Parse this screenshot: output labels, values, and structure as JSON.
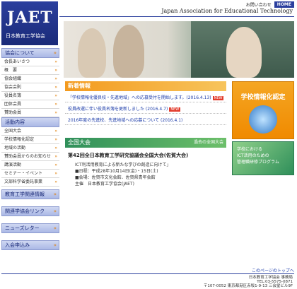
{
  "header": {
    "logo_text": "JAET",
    "logo_subtitle": "日本教育工学協会",
    "contact_link": "お問い合わせ",
    "home_link": "HOME",
    "english_name": "Japan Association for Educational Technology"
  },
  "sidebar": {
    "sections": [
      {
        "title": "協会について",
        "items": [
          "会長あいさつ",
          "概　要",
          "協会組織",
          "協会会則",
          "役員名簿",
          "団体会員",
          "賛助会員"
        ]
      },
      {
        "title": "活動内容",
        "items": [
          "全国大会",
          "学校情報化認定",
          "地域の活動",
          "賛助会員からのお知らせ",
          "講演活動",
          "セミナー・イベント",
          "文部科学省委託事業"
        ]
      },
      {
        "title": "教育工学関連情報",
        "items": []
      },
      {
        "title": "関連学協会リンク",
        "items": []
      },
      {
        "title": "ニューズレター",
        "items": []
      },
      {
        "title": "入会申込み",
        "items": []
      }
    ]
  },
  "news": {
    "heading": "新着情報",
    "items": [
      {
        "text": "「学校情報化優良校・先進地域」への応募受付を開始します。(2016.4.13)",
        "new": "NEW"
      },
      {
        "text": "役員改選に伴い役員名簿を更新しました (2016.4.7)",
        "new": "NEW"
      },
      {
        "text": "2016年度の先進校、先進地域への応募について (2016.4.1)",
        "new": ""
      }
    ]
  },
  "zenkoku": {
    "heading": "全国大会",
    "more_link": "過去の全国大会",
    "title": "第42回全日本教育工学研究協議会全国大会(佐賀大会)",
    "lines": [
      "ICT利活用教育による新たな学びの創造に向けて」",
      "■日程：平成28年10月14日(金)・15日(土)",
      "■会場：佐賀市文化会館、佐賀県青年会館",
      "主催　日本教育工学協会(JAET)"
    ]
  },
  "banners": {
    "certification": "学校情報化認定",
    "program_line1": "学校における",
    "program_line2": "ICT活用のための",
    "program_line3": "管理職研修プログラム"
  },
  "footer": {
    "page_top": "このページのトップへ",
    "org": "日本教育工学協会 事務局",
    "tel": "TEL:03-5575-0871",
    "address": "〒107-0052 東京都港区赤坂1-9-13 三会堂ビル9F"
  },
  "colors": {
    "brand": "#2b3f9e",
    "news": "#f39a1e",
    "zenkoku": "#2f8f5a",
    "new_badge": "#e23b2b"
  }
}
